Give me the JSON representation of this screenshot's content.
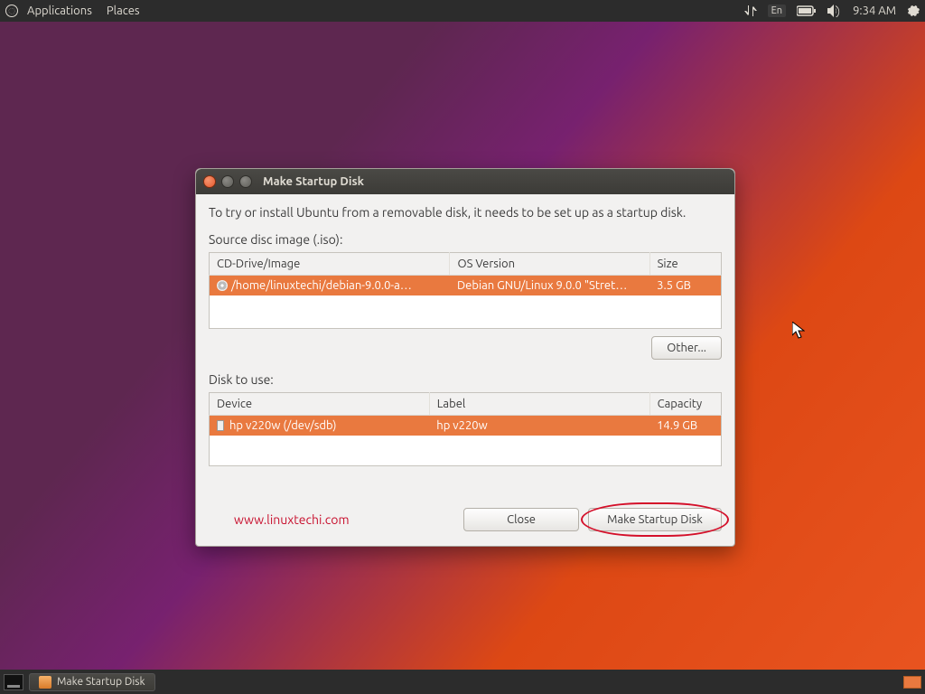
{
  "menubar": {
    "applications": "Applications",
    "places": "Places",
    "lang": "En",
    "time": "9:34 AM"
  },
  "window": {
    "title": "Make Startup Disk",
    "instruction": "To try or install Ubuntu from a removable disk, it needs to be set up as a startup disk.",
    "source_label": "Source disc image (.iso):",
    "source_table": {
      "col_image": "CD-Drive/Image",
      "col_os": "OS Version",
      "col_size": "Size",
      "row": {
        "image": "/home/linuxtechi/debian-9.0.0-a…",
        "os": "Debian GNU/Linux 9.0.0 \"Stret…",
        "size": "3.5 GB"
      }
    },
    "other_btn": "Other...",
    "disk_label": "Disk to use:",
    "disk_table": {
      "col_device": "Device",
      "col_label": "Label",
      "col_capacity": "Capacity",
      "row": {
        "device": "hp v220w (/dev/sdb)",
        "label": "hp v220w",
        "capacity": "14.9 GB"
      }
    },
    "watermark": "www.linuxtechi.com",
    "close_btn": "Close",
    "make_btn": "Make Startup Disk"
  },
  "taskbar": {
    "item": "Make Startup Disk"
  }
}
